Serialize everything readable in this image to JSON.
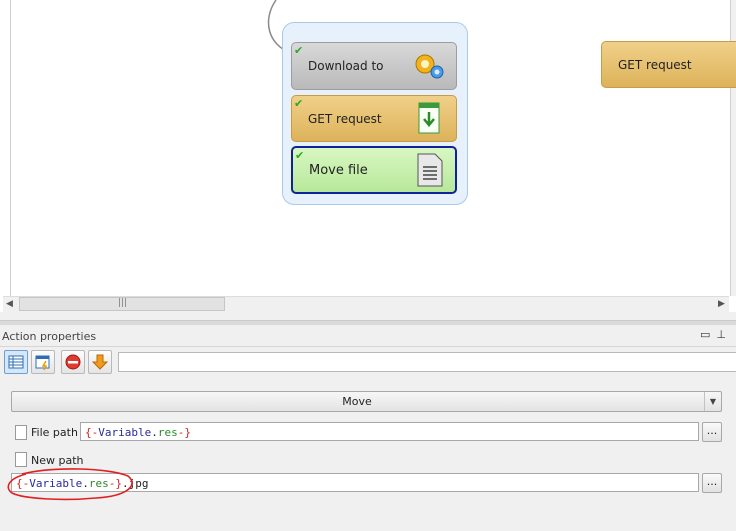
{
  "canvas": {
    "nodes": {
      "download_to": {
        "label": "Download to"
      },
      "get_request": {
        "label": "GET request"
      },
      "move_file": {
        "label": "Move file"
      },
      "get_request_right": {
        "label": "GET request"
      }
    }
  },
  "panel": {
    "title": "Action properties",
    "toolbar_field_value": "",
    "action": {
      "selected": "Move"
    },
    "file_path": {
      "label": "File path",
      "brace_open": "{-",
      "var_name": "Variable",
      "var_res": "res",
      "brace_close": "-}",
      "suffix": ""
    },
    "new_path": {
      "label": "New path",
      "brace_open": "{-",
      "var_name": "Variable",
      "var_res": "res",
      "brace_close": "-}",
      "suffix": ".jpg"
    },
    "browse_label": "..."
  },
  "colors": {
    "accent_border": "#0f2399",
    "annotation": "#e02020"
  }
}
